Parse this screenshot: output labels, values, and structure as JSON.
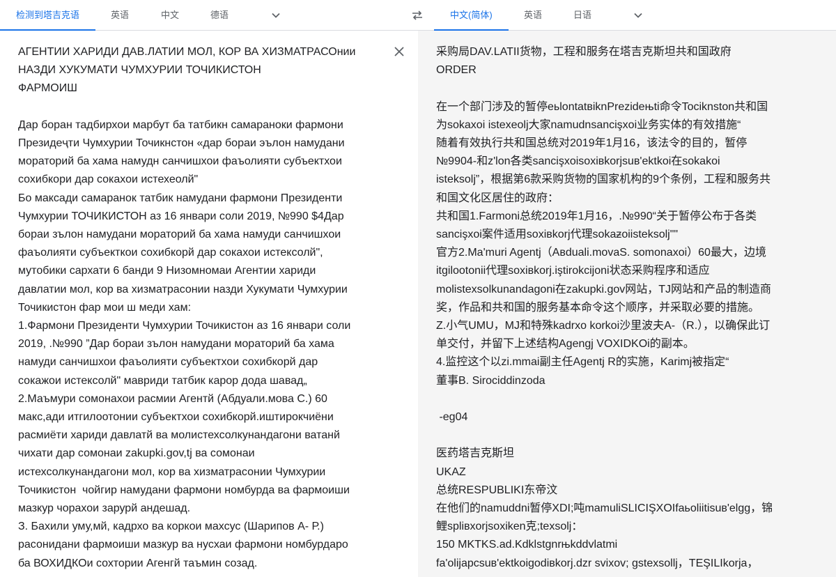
{
  "source_tabs": {
    "detected": "检测到塔吉克语",
    "lang1": "英语",
    "lang2": "中文",
    "lang3": "德语"
  },
  "target_tabs": {
    "selected": "中文(简体)",
    "lang1": "英语",
    "lang2": "日语"
  },
  "icons": {
    "source_more": "chevron-down-icon",
    "swap": "swap-icon",
    "target_more": "chevron-down-icon",
    "clear": "close-icon"
  },
  "colors": {
    "accent": "#1a73e8",
    "tab_text": "#5f6368",
    "body_text": "#202124",
    "target_bg": "#f5f5f5",
    "divider": "#dadce0"
  },
  "source_text": "АГЕНТИИ ХАРИДИ ДАВ.ЛАТИИ МОЛ, КОР ВА ХИЗМАТРАСОнии\nНАЗДИ ХУКУМАТИ ЧУМХУРИИ ТОЧИКИСТОН\nФАРМОИШ\n\nДар боран тадбирхои марбут ба татбикн самараноки фармони\nПрезидеҷти Чумхурии Точикнстон «дар бораи эълон намудани\nмораторий ба хама намудн санчишхои фаъолияти субъектхои\nсохибкори дар сокахои истехеолй\"\nБо максади самаранок татбик намудани фармони Президенти\nЧумхурии ТОЧИКИСТОН аз 16 январи соли 2019, №990 $4Дар\nбораи зълон намудани мораторий ба хама намуди санчишхои\nфаъолияти субъекткои сохибкорй дар сокахои истексолй\",\nмутобики сархати 6 банди 9 Низомномаи Агентии хариди\nдавлатии мол, кор ва хизматрасонии назди Хукумати Чумхурии\nТочикистон фар мои ш меди хам:\n1.Фармони Президенти Чумхурии Точикистон аз 16 январи соли\n2019, .№990 ”Дар бораи зълон намудани мораторий ба хама\nнамуди санчишхои фаъолияти субъектхои сохибкорй дар\nсокажои истексолй\" мавриди татбик карор дода шавад„\n2.Маъмури сомонахои расмии Агентй (Абдуали.мова С.) 60\nмакс,ади итгилоотонии субъектхои сохибкорй.иштирокчиёни\nрасмиёти хариди давлатй ва молистехсолкунандагони ватанй\nчихати дар сомонаи zakupki.gov,tj ва сомонаи\nистехсолкунандагони мол, кор ва хизматрасонии Чумхурии\nТочикистон  чойгир намудани фармони номбурда ва фармоиши\nмазкур чорахои зарурй андешад.\nЗ. Бахили уму,мй, кадрхо ва коркои махсус (Шарипов А- Р.)\nрасонидани фармоиши мазкур ва нусхаи фармони номбурдаро\nба ВОХИДКОи сохтории Агенгй таъмин созад.",
  "target_text": "采购局DAV.LATII货物，工程和服务在塔吉克斯坦共和国政府\nORDER\n\n在一个部门涉及的暂停eьlontatвiknPrezideњti命令Tociknston共和国\n为sokaxoi istexeolj大家namudnsancişxoi业务实体的有效措施“\n随着有效执行共和国总统对2019年1月16，该法令的目的，暂停\n№9904-和z'lon各类sancişxoisoxiвkorjsuв'ektkoi在sokakoi\nisteksolj”，根据第6款采购货物的国家机构的9个条例，工程和服务共\n和国文化区居住的政府：\n共和国1.Farmoni总统2019年1月16，.№990“关于暂停公布于各类\nsancişxoi案件适用soxiвkorj代理sokaƶoiisteksolj\"\"\n官方2.Ma'muri Agentj（Aвduali.movaS. somonaxoi）60最大，边境\nitgilootonii代理soxiвkorj.iştirokcijoni状态采购程序和适应\nmolistexsolkunandagoni在zakupki.gov网站，TJ网站和产品的制造商\n奖，作品和共和国的服务基本命令这个顺序，并采取必要的措施。\nZ.小气UMU，MJ和特殊kadrxo korkoi沙里波夫A-（R.），以确保此订\n单交付，并留下上述结构Agengj VOXIDKOi的副本。\n4.监控这个以zi.mmai副主任Agentj R的实施，Karimj被指定“\n董事B. Sirociddinzoda\n\n -eg04\n\n医药塔吉克斯坦\nUKAZ\n总统RESPUBLIKI东帝汶\n在他们的namuddni暂停XDI;吨mamuliSLICIŞXOIfaьoliitisuв'elgg，锦\n鲤spliвxorjsoxiken克;texsolj：\n150 MKTKS.ad.Kdklstgnrњkddvlatmi\nfa'olijapcsuв'ektkoigodiвkorj.dzr svixov; gstexsollj，TEŞILIkorja，"
}
